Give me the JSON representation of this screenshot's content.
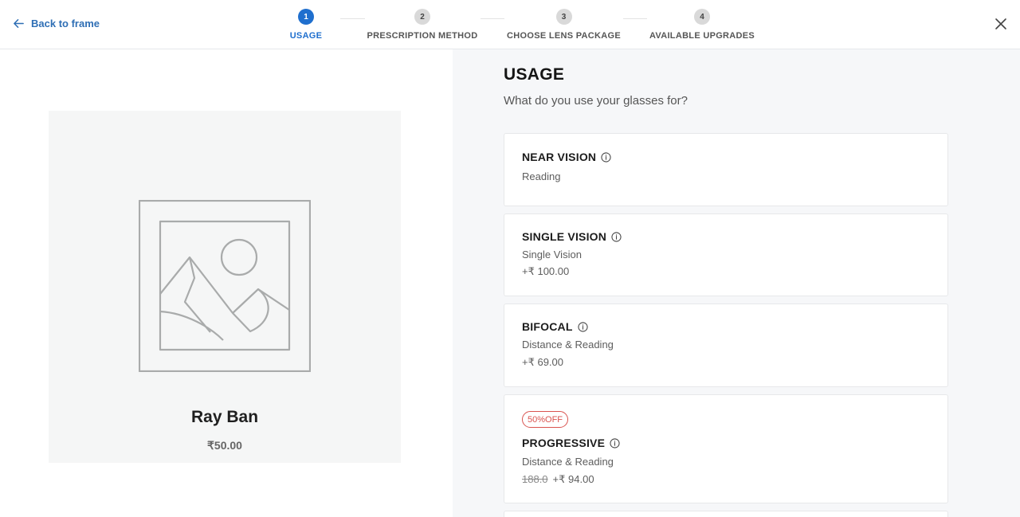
{
  "header": {
    "back_label": "Back to frame",
    "steps": [
      {
        "num": "1",
        "label": "USAGE"
      },
      {
        "num": "2",
        "label": "PRESCRIPTION METHOD"
      },
      {
        "num": "3",
        "label": "CHOOSE LENS PACKAGE"
      },
      {
        "num": "4",
        "label": "AVAILABLE UPGRADES"
      }
    ],
    "active_step": 1
  },
  "product": {
    "name": "Ray Ban",
    "price": "₹50.00"
  },
  "usage": {
    "title": "USAGE",
    "subtitle": "What do you use your glasses for?",
    "options": [
      {
        "title": "NEAR VISION",
        "desc": "Reading",
        "price": ""
      },
      {
        "title": "SINGLE VISION",
        "desc": "Single Vision",
        "price": "+₹ 100.00"
      },
      {
        "title": "BIFOCAL",
        "desc": "Distance & Reading",
        "price": "+₹ 69.00"
      },
      {
        "title": "PROGRESSIVE",
        "desc": "Distance & Reading",
        "badge": "50%OFF",
        "old_price": "188.0",
        "price": "+₹ 94.00"
      }
    ]
  },
  "colors": {
    "accent": "#1f6fce",
    "link": "#2f6fb5",
    "discount": "#d9534f",
    "panel_bg": "#f6f7f9"
  }
}
